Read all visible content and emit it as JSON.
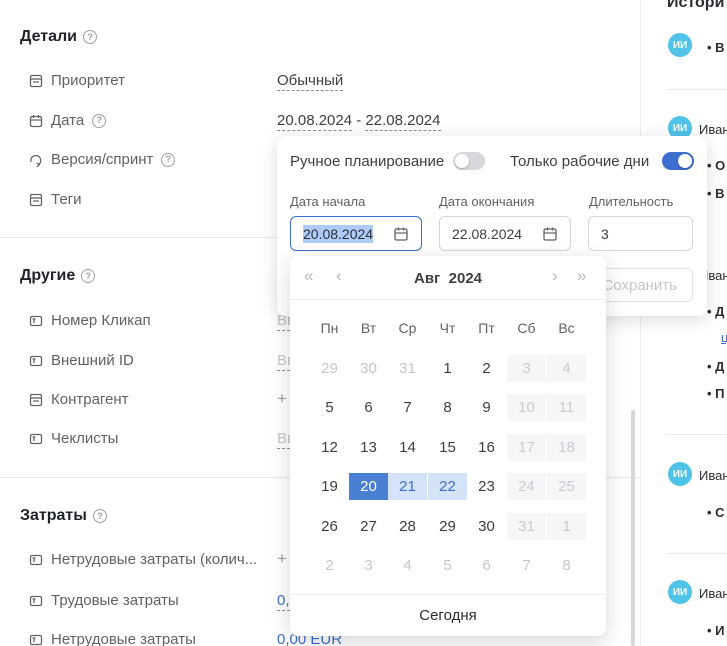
{
  "details": {
    "title": "Детали",
    "rows": [
      {
        "label": "Приоритет",
        "icon": "list-icon",
        "value": "Обычный"
      },
      {
        "label": "Дата",
        "icon": "calendar-icon",
        "value_start": "20.08.2024",
        "value_sep": "-",
        "value_end": "22.08.2024"
      },
      {
        "label": "Версия/спринт",
        "icon": "sprint-icon"
      },
      {
        "label": "Теги",
        "icon": "list-icon"
      }
    ]
  },
  "other": {
    "title": "Другие",
    "rows": [
      {
        "label": "Номер Кликап",
        "icon": "text-field-icon",
        "value": "Вв"
      },
      {
        "label": "Внешний ID",
        "icon": "text-field-icon",
        "value": "Вв"
      },
      {
        "label": "Контрагент",
        "icon": "list-icon",
        "value": "+"
      },
      {
        "label": "Чеклисты",
        "icon": "text-field-icon",
        "value": "Вв"
      }
    ]
  },
  "costs": {
    "title": "Затраты",
    "rows": [
      {
        "label": "Нетрудовые затраты (колич...",
        "icon": "text-field-icon",
        "value": "+"
      },
      {
        "label": "Трудовые затраты",
        "icon": "text-field-icon",
        "value": "0,"
      },
      {
        "label": "Нетрудовые затраты",
        "icon": "text-field-icon",
        "value": "0,00 EUR"
      }
    ]
  },
  "history": {
    "title": "Истори",
    "entries": [
      {
        "avatar": "ИИ",
        "name": "",
        "bullets": [
          "В"
        ]
      },
      {
        "avatar": "ИИ",
        "name": "Иван",
        "bullets": [
          "О",
          "В"
        ]
      },
      {
        "avatar": "",
        "name": "Иван",
        "bullets": [
          "Д",
          "ц",
          "Д",
          "П"
        ]
      },
      {
        "avatar": "ИИ",
        "name": "Иван",
        "bullets": [
          "С"
        ]
      },
      {
        "avatar": "ИИ",
        "name": "Иван",
        "bullets": [
          "И"
        ]
      }
    ]
  },
  "date_popup": {
    "manual_label": "Ручное планирование",
    "manual_on": false,
    "workdays_label": "Только рабочие дни",
    "workdays_on": true,
    "start_label": "Дата начала",
    "start_value": "20.08.2024",
    "end_label": "Дата окончания",
    "end_value": "22.08.2024",
    "duration_label": "Длительность",
    "duration_value": "3",
    "save_label": "Сохранить"
  },
  "calendar": {
    "month": "Авг",
    "year": "2024",
    "weekdays": [
      "Пн",
      "Вт",
      "Ср",
      "Чт",
      "Пт",
      "Сб",
      "Вс"
    ],
    "weeks": [
      [
        "29",
        "30",
        "31",
        "1",
        "2",
        "3",
        "4"
      ],
      [
        "5",
        "6",
        "7",
        "8",
        "9",
        "10",
        "11"
      ],
      [
        "12",
        "13",
        "14",
        "15",
        "16",
        "17",
        "18"
      ],
      [
        "19",
        "20",
        "21",
        "22",
        "23",
        "24",
        "25"
      ],
      [
        "26",
        "27",
        "28",
        "29",
        "30",
        "31",
        "1"
      ],
      [
        "2",
        "3",
        "4",
        "5",
        "6",
        "7",
        "8"
      ]
    ],
    "selected_day": "20",
    "range_end_day": "22",
    "today_label": "Сегодня"
  },
  "colors": {
    "accent": "#3d6fd1",
    "avatar": "#4fc3e8"
  }
}
